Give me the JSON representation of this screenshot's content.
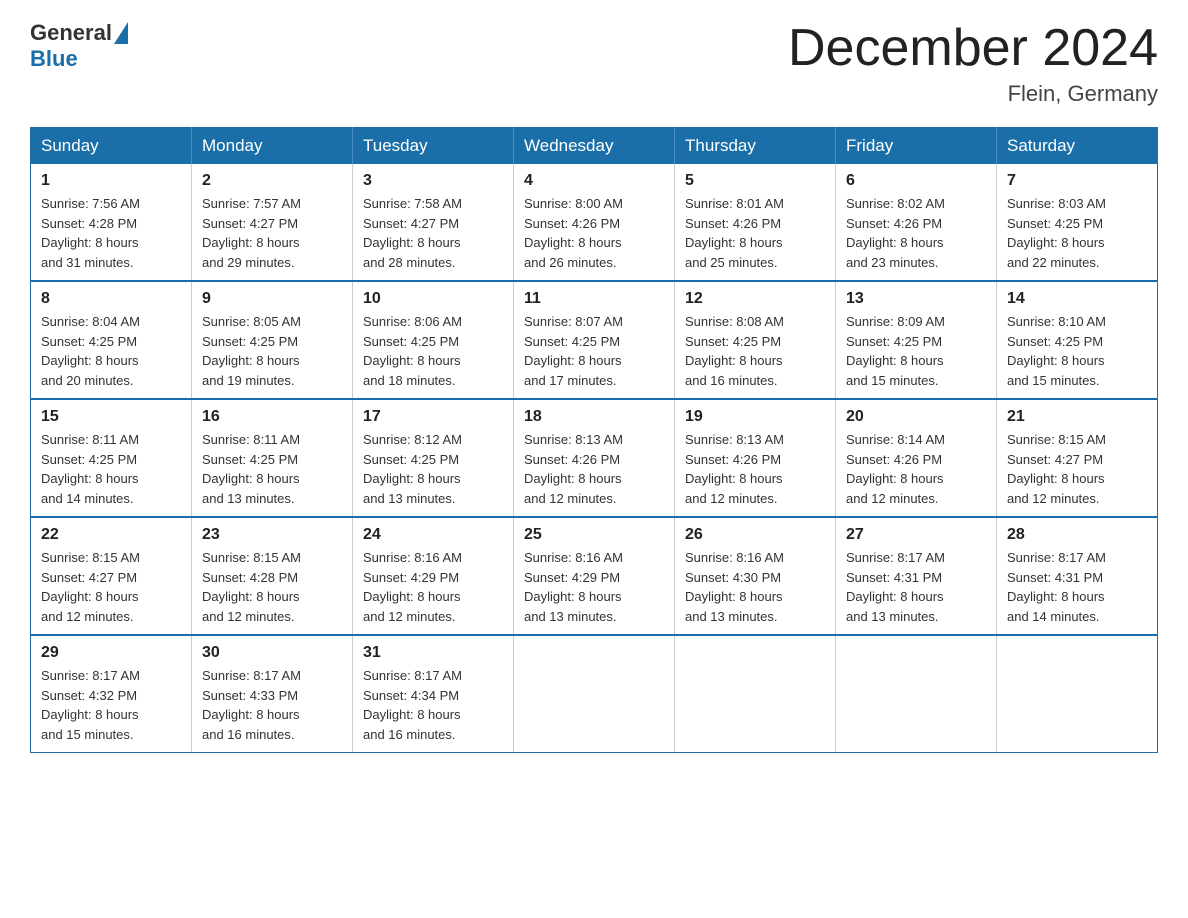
{
  "logo": {
    "general": "General",
    "blue": "Blue"
  },
  "title": "December 2024",
  "location": "Flein, Germany",
  "days_of_week": [
    "Sunday",
    "Monday",
    "Tuesday",
    "Wednesday",
    "Thursday",
    "Friday",
    "Saturday"
  ],
  "weeks": [
    [
      {
        "day": "1",
        "sunrise": "7:56 AM",
        "sunset": "4:28 PM",
        "daylight": "8 hours and 31 minutes."
      },
      {
        "day": "2",
        "sunrise": "7:57 AM",
        "sunset": "4:27 PM",
        "daylight": "8 hours and 29 minutes."
      },
      {
        "day": "3",
        "sunrise": "7:58 AM",
        "sunset": "4:27 PM",
        "daylight": "8 hours and 28 minutes."
      },
      {
        "day": "4",
        "sunrise": "8:00 AM",
        "sunset": "4:26 PM",
        "daylight": "8 hours and 26 minutes."
      },
      {
        "day": "5",
        "sunrise": "8:01 AM",
        "sunset": "4:26 PM",
        "daylight": "8 hours and 25 minutes."
      },
      {
        "day": "6",
        "sunrise": "8:02 AM",
        "sunset": "4:26 PM",
        "daylight": "8 hours and 23 minutes."
      },
      {
        "day": "7",
        "sunrise": "8:03 AM",
        "sunset": "4:25 PM",
        "daylight": "8 hours and 22 minutes."
      }
    ],
    [
      {
        "day": "8",
        "sunrise": "8:04 AM",
        "sunset": "4:25 PM",
        "daylight": "8 hours and 20 minutes."
      },
      {
        "day": "9",
        "sunrise": "8:05 AM",
        "sunset": "4:25 PM",
        "daylight": "8 hours and 19 minutes."
      },
      {
        "day": "10",
        "sunrise": "8:06 AM",
        "sunset": "4:25 PM",
        "daylight": "8 hours and 18 minutes."
      },
      {
        "day": "11",
        "sunrise": "8:07 AM",
        "sunset": "4:25 PM",
        "daylight": "8 hours and 17 minutes."
      },
      {
        "day": "12",
        "sunrise": "8:08 AM",
        "sunset": "4:25 PM",
        "daylight": "8 hours and 16 minutes."
      },
      {
        "day": "13",
        "sunrise": "8:09 AM",
        "sunset": "4:25 PM",
        "daylight": "8 hours and 15 minutes."
      },
      {
        "day": "14",
        "sunrise": "8:10 AM",
        "sunset": "4:25 PM",
        "daylight": "8 hours and 15 minutes."
      }
    ],
    [
      {
        "day": "15",
        "sunrise": "8:11 AM",
        "sunset": "4:25 PM",
        "daylight": "8 hours and 14 minutes."
      },
      {
        "day": "16",
        "sunrise": "8:11 AM",
        "sunset": "4:25 PM",
        "daylight": "8 hours and 13 minutes."
      },
      {
        "day": "17",
        "sunrise": "8:12 AM",
        "sunset": "4:25 PM",
        "daylight": "8 hours and 13 minutes."
      },
      {
        "day": "18",
        "sunrise": "8:13 AM",
        "sunset": "4:26 PM",
        "daylight": "8 hours and 12 minutes."
      },
      {
        "day": "19",
        "sunrise": "8:13 AM",
        "sunset": "4:26 PM",
        "daylight": "8 hours and 12 minutes."
      },
      {
        "day": "20",
        "sunrise": "8:14 AM",
        "sunset": "4:26 PM",
        "daylight": "8 hours and 12 minutes."
      },
      {
        "day": "21",
        "sunrise": "8:15 AM",
        "sunset": "4:27 PM",
        "daylight": "8 hours and 12 minutes."
      }
    ],
    [
      {
        "day": "22",
        "sunrise": "8:15 AM",
        "sunset": "4:27 PM",
        "daylight": "8 hours and 12 minutes."
      },
      {
        "day": "23",
        "sunrise": "8:15 AM",
        "sunset": "4:28 PM",
        "daylight": "8 hours and 12 minutes."
      },
      {
        "day": "24",
        "sunrise": "8:16 AM",
        "sunset": "4:29 PM",
        "daylight": "8 hours and 12 minutes."
      },
      {
        "day": "25",
        "sunrise": "8:16 AM",
        "sunset": "4:29 PM",
        "daylight": "8 hours and 13 minutes."
      },
      {
        "day": "26",
        "sunrise": "8:16 AM",
        "sunset": "4:30 PM",
        "daylight": "8 hours and 13 minutes."
      },
      {
        "day": "27",
        "sunrise": "8:17 AM",
        "sunset": "4:31 PM",
        "daylight": "8 hours and 13 minutes."
      },
      {
        "day": "28",
        "sunrise": "8:17 AM",
        "sunset": "4:31 PM",
        "daylight": "8 hours and 14 minutes."
      }
    ],
    [
      {
        "day": "29",
        "sunrise": "8:17 AM",
        "sunset": "4:32 PM",
        "daylight": "8 hours and 15 minutes."
      },
      {
        "day": "30",
        "sunrise": "8:17 AM",
        "sunset": "4:33 PM",
        "daylight": "8 hours and 16 minutes."
      },
      {
        "day": "31",
        "sunrise": "8:17 AM",
        "sunset": "4:34 PM",
        "daylight": "8 hours and 16 minutes."
      },
      null,
      null,
      null,
      null
    ]
  ],
  "labels": {
    "sunrise": "Sunrise:",
    "sunset": "Sunset:",
    "daylight": "Daylight:"
  }
}
